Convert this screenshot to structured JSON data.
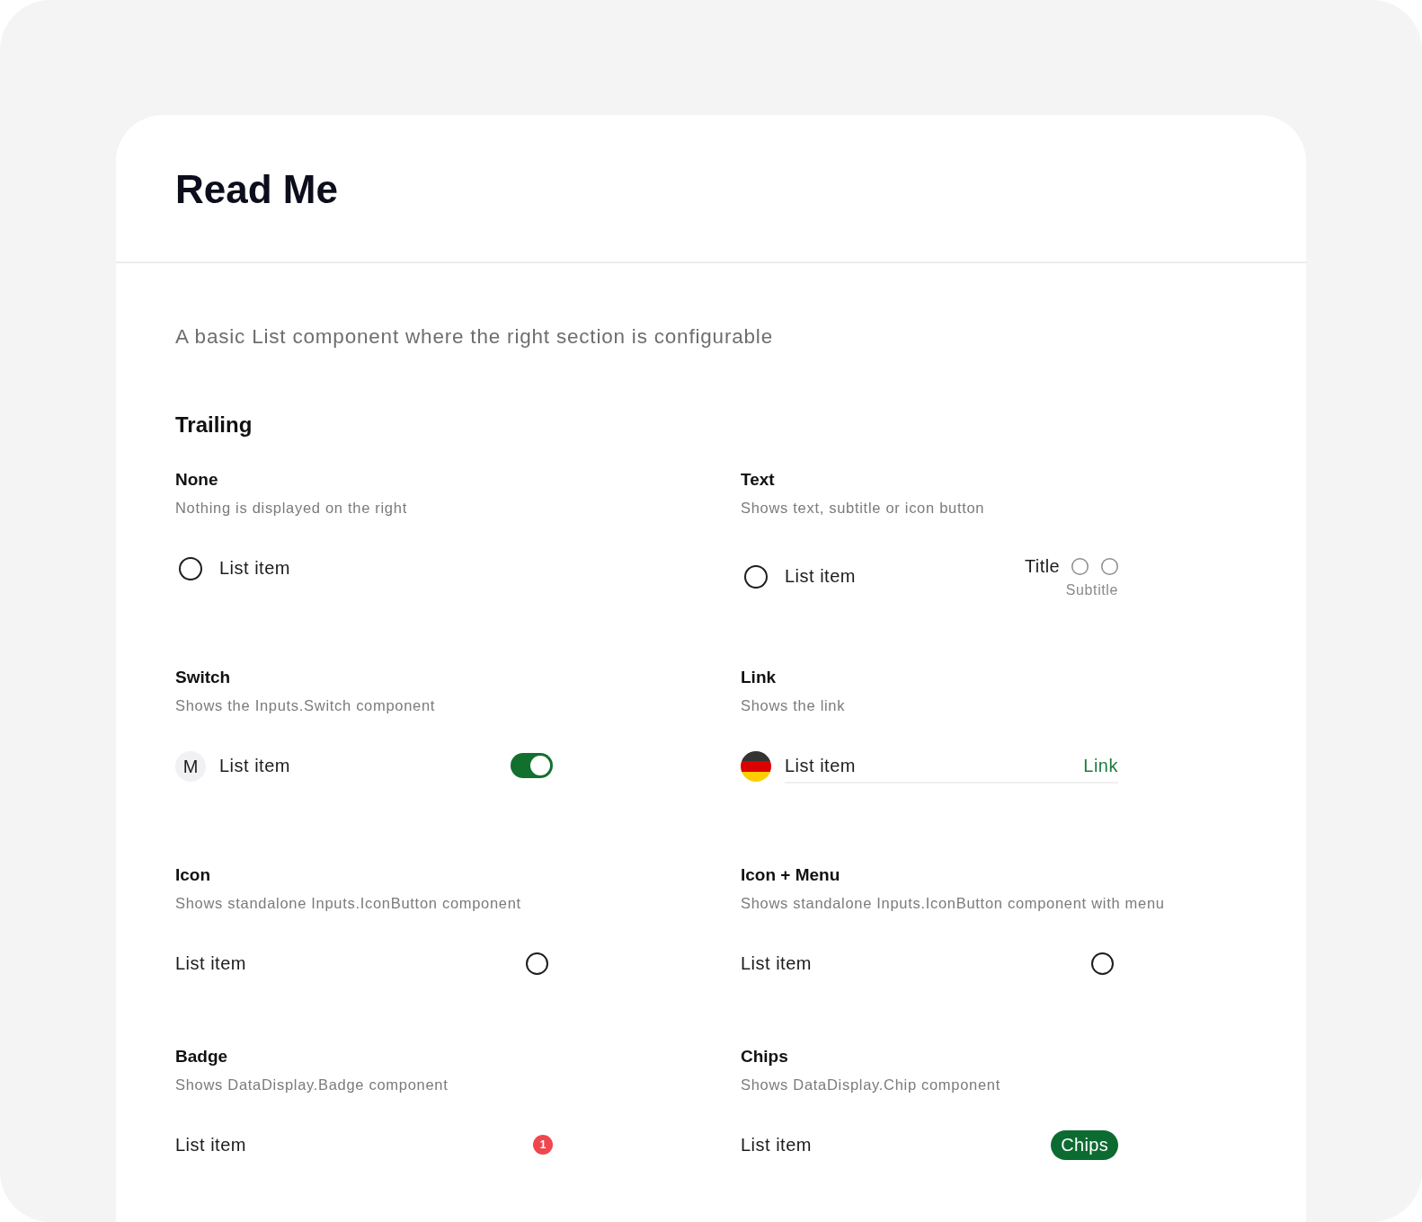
{
  "page": {
    "title": "Read Me",
    "description": "A basic List component where the right section is configurable"
  },
  "section": {
    "heading": "Trailing"
  },
  "examples": [
    {
      "title": "None",
      "description": "Nothing is displayed on the right",
      "item": {
        "leading": {
          "kind": "icon"
        },
        "label": "List item",
        "divider": false,
        "trailing": {
          "kind": "none"
        }
      }
    },
    {
      "title": "Text",
      "description": "Shows text, subtitle or icon button",
      "item": {
        "leading": {
          "kind": "icon"
        },
        "label": "List item",
        "divider": false,
        "trailing": {
          "kind": "text",
          "title": "Title",
          "subtitle": "Subtitle",
          "actions": [
            {
              "kind": "icon_button"
            },
            {
              "kind": "icon_button"
            }
          ]
        }
      }
    },
    {
      "title": "Switch",
      "description": "Shows the Inputs.Switch component",
      "item": {
        "leading": {
          "kind": "avatar",
          "text": "M"
        },
        "label": "List item",
        "divider": false,
        "trailing": {
          "kind": "switch",
          "on": true
        }
      }
    },
    {
      "title": "Link",
      "description": "Shows the link",
      "item": {
        "leading": {
          "kind": "flag"
        },
        "label": "List item",
        "divider": true,
        "trailing": {
          "kind": "link",
          "label": "Link"
        }
      }
    },
    {
      "title": "Icon",
      "description": "Shows standalone Inputs.IconButton component",
      "item": {
        "label": "List item",
        "divider": false,
        "trailing": {
          "kind": "icon_button"
        }
      }
    },
    {
      "title": "Icon + Menu",
      "description": "Shows standalone Inputs.IconButton component with menu",
      "item": {
        "label": "List item",
        "divider": false,
        "trailing": {
          "kind": "icon_button"
        }
      }
    },
    {
      "title": "Badge",
      "description": "Shows DataDisplay.Badge component",
      "item": {
        "label": "List item",
        "divider": false,
        "trailing": {
          "kind": "badge",
          "count": "1"
        }
      }
    },
    {
      "title": "Chips",
      "description": "Shows DataDisplay.Chip component",
      "item": {
        "label": "List item",
        "divider": false,
        "trailing": {
          "kind": "chip",
          "label": "Chips"
        }
      }
    }
  ]
}
